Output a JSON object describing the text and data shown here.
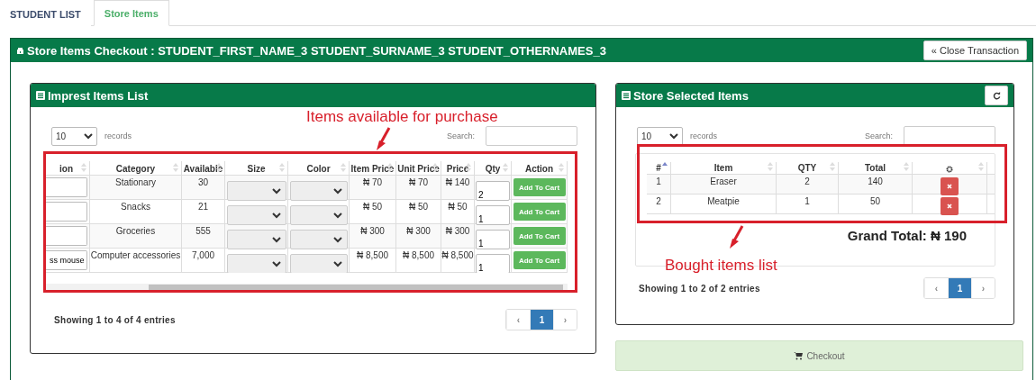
{
  "tabs": [
    {
      "label": "STUDENT LIST",
      "selected": false
    },
    {
      "label": "Store Items",
      "selected": true
    }
  ],
  "checkout_panel": {
    "title": "Store Items Checkout : STUDENT_FIRST_NAME_3 STUDENT_SURNAME_3 STUDENT_OTHERNAMES_3",
    "close_button": "« Close Transaction"
  },
  "imprest_panel": {
    "title": "Imprest Items List",
    "page_length": "10",
    "records_label": "records",
    "search_label": "Search:",
    "columns": [
      "ion",
      "Category",
      "Available",
      "Size",
      "Color",
      "Item Price",
      "Unit Price",
      "Price",
      "Qty",
      "Action"
    ],
    "rows": [
      {
        "category": "Stationary",
        "available": "30",
        "item_price": "₦ 70",
        "unit_price": "₦ 70",
        "price": "₦ 140",
        "qty": "2",
        "action": "Add To Cart"
      },
      {
        "category": "Snacks",
        "available": "21",
        "item_price": "₦ 50",
        "unit_price": "₦ 50",
        "price": "₦ 50",
        "qty": "1",
        "action": "Add To Cart"
      },
      {
        "category": "Groceries",
        "available": "555",
        "item_price": "₦ 300",
        "unit_price": "₦ 300",
        "price": "₦ 300",
        "qty": "1",
        "action": "Add To Cart"
      },
      {
        "description": "ss mouse",
        "category": "Computer accessories",
        "available": "7,000",
        "item_price": "₦ 8,500",
        "unit_price": "₦ 8,500",
        "price": "₦ 8,500",
        "qty": "1",
        "action": "Add To Cart"
      }
    ],
    "info": "Showing 1 to 4 of 4 entries",
    "pagination": [
      {
        "label": "‹",
        "selected": false
      },
      {
        "label": "1",
        "selected": true
      },
      {
        "label": "›",
        "selected": false
      }
    ]
  },
  "selected_panel": {
    "title": "Store Selected Items",
    "page_length": "10",
    "records_label": "records",
    "search_label": "Search:",
    "columns": [
      {
        "kind": "text",
        "label": "#",
        "sorted": true
      },
      {
        "kind": "text",
        "label": "Item",
        "sorted": false
      },
      {
        "kind": "text",
        "label": "QTY",
        "sorted": false
      },
      {
        "kind": "text",
        "label": "Total",
        "sorted": false
      },
      {
        "kind": "settings",
        "sorted": false
      }
    ],
    "rows": [
      {
        "index": "1",
        "item": "Eraser",
        "qty": "2",
        "total": "140"
      },
      {
        "index": "2",
        "item": "Meatpie",
        "qty": "1",
        "total": "50"
      }
    ],
    "grand_total": "Grand Total: ₦ 190",
    "info": "Showing 1 to 2 of 2 entries",
    "pagination": [
      {
        "label": "‹",
        "selected": false
      },
      {
        "label": "1",
        "selected": true
      },
      {
        "label": "›",
        "selected": false
      }
    ]
  },
  "checkout_button": "Checkout",
  "annotations": [
    {
      "text": "Items available for purchase"
    },
    {
      "text": "Bought items list"
    }
  ]
}
